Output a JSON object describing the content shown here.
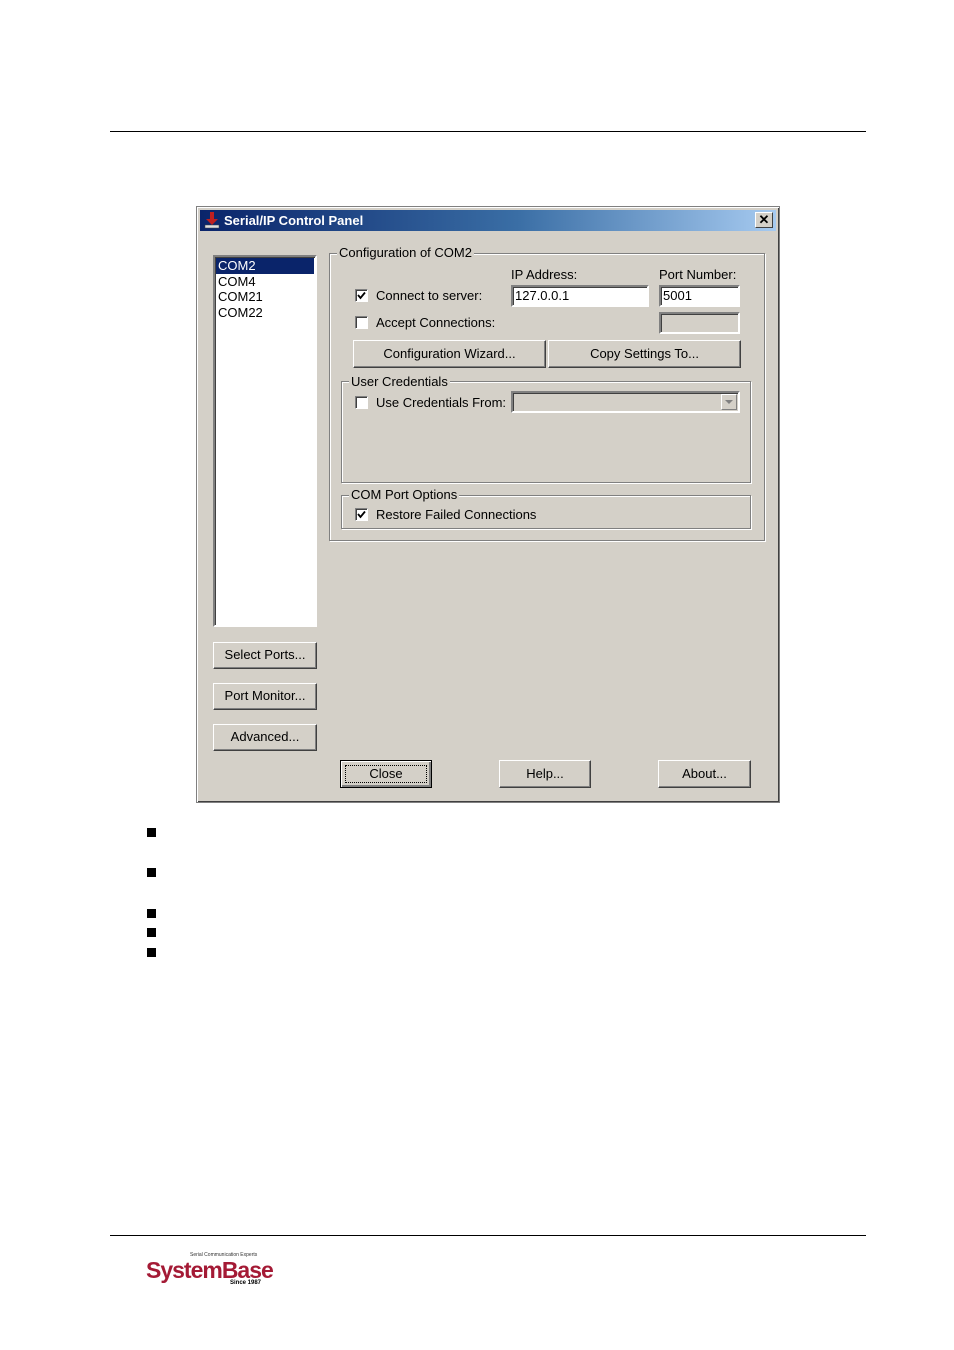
{
  "window": {
    "title": "Serial/IP Control Panel",
    "close_glyph": "✕"
  },
  "ports": [
    "COM2",
    "COM4",
    "COM21",
    "COM22"
  ],
  "selected_port": "COM2",
  "left_buttons": {
    "select_ports": "Select Ports...",
    "port_monitor": "Port Monitor...",
    "advanced": "Advanced..."
  },
  "config": {
    "group_label": "Configuration of COM2",
    "ip_address_label": "IP Address:",
    "port_number_label": "Port Number:",
    "connect_to_server_label": "Connect to server:",
    "connect_to_server_checked": true,
    "ip_address_value": "127.0.0.1",
    "port_number_value": "5001",
    "accept_connections_label": "Accept Connections:",
    "accept_connections_checked": false,
    "accept_port_value": "",
    "configuration_wizard": "Configuration Wizard...",
    "copy_settings": "Copy Settings To..."
  },
  "credentials": {
    "group_label": "User Credentials",
    "use_credentials_label": "Use Credentials From:",
    "use_credentials_checked": false,
    "credentials_value": ""
  },
  "com_options": {
    "group_label": "COM Port Options",
    "restore_label": "Restore Failed Connections",
    "restore_checked": true
  },
  "bottom_buttons": {
    "close": "Close",
    "help": "Help...",
    "about": "About..."
  },
  "logo": {
    "tagline": "Serial Communication Experts",
    "brand": "SystemBase",
    "since": "Since 1987"
  },
  "colors": {
    "dialog_face": "#d4d0c8",
    "title_gradient_start": "#0a246a",
    "selection": "#0a246a",
    "brand": "#a41a35"
  }
}
